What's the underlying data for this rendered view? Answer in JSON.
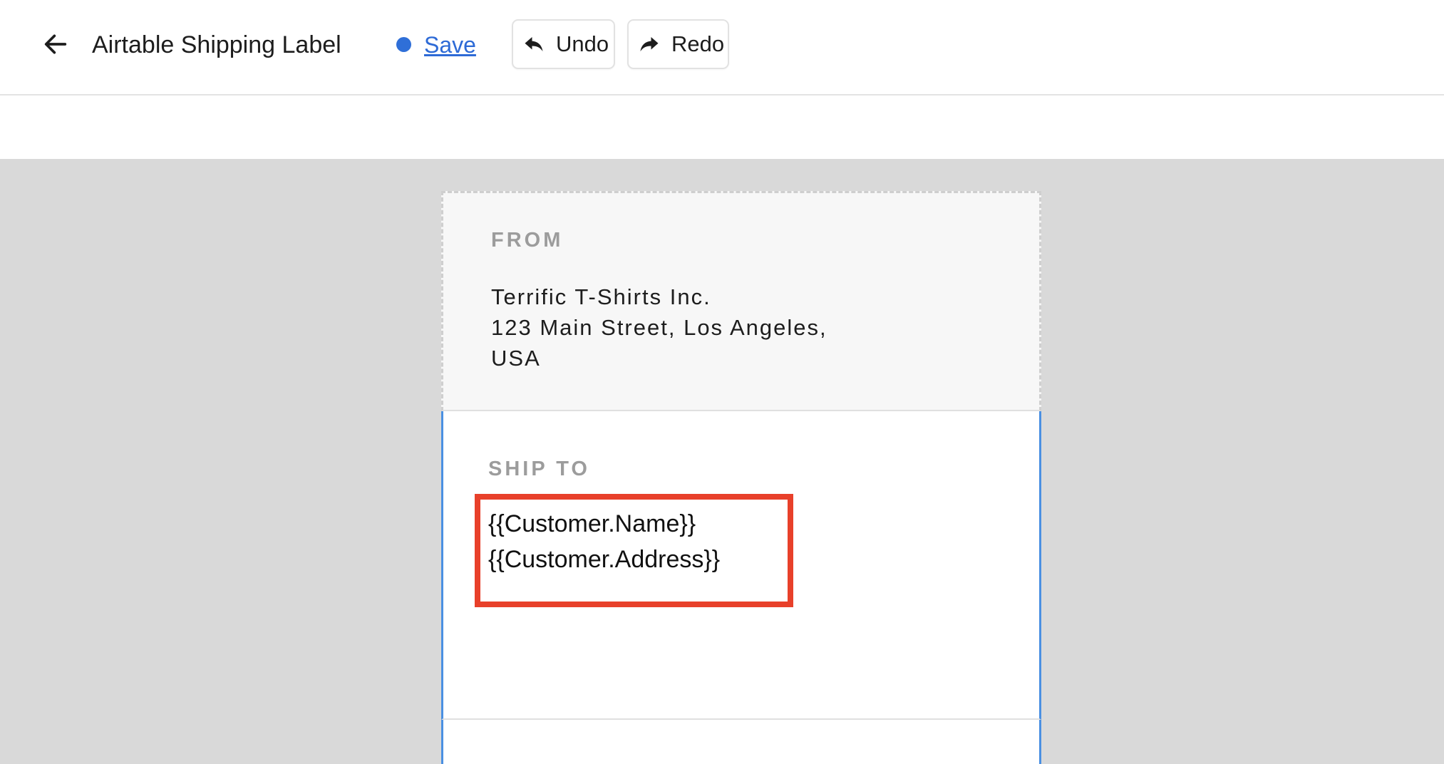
{
  "header": {
    "title": "Airtable Shipping Label",
    "save_label": "Save",
    "undo_label": "Undo",
    "redo_label": "Redo",
    "status_color": "#2f6fd8",
    "icons": {
      "back": "arrow-left-icon",
      "undo": "undo-arrow-icon",
      "redo": "redo-arrow-icon"
    }
  },
  "label": {
    "from": {
      "heading": "FROM",
      "lines": [
        "Terrific T-Shirts Inc.",
        "123 Main Street, Los Angeles,",
        "USA"
      ]
    },
    "ship_to": {
      "heading": "SHIP TO",
      "lines": [
        "{{Customer.Name}}",
        "{{Customer.Address}}"
      ]
    }
  },
  "colors": {
    "accent": "#2d6ad6",
    "selection_border": "#4a90e2",
    "highlight": "#e8402a",
    "canvas_background": "#d9d9d9"
  }
}
